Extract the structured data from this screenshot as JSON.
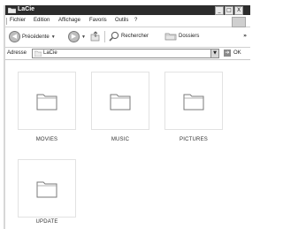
{
  "window": {
    "title": "LaCie",
    "minimize": "_",
    "maximize": "□",
    "close": "X"
  },
  "menu": [
    "Fichier",
    "Edition",
    "Affichage",
    "Favoris",
    "Outils",
    "?"
  ],
  "toolbar": {
    "back_label": "Précédente",
    "search_label": "Rechercher",
    "folders_label": "Dossiers",
    "more": "»"
  },
  "address": {
    "label": "Adresse",
    "value": "LaCie",
    "go_label": "OK"
  },
  "folders": [
    {
      "name": "MOVIES"
    },
    {
      "name": "MUSIC"
    },
    {
      "name": "PICTURES"
    },
    {
      "name": "UPDATE"
    }
  ]
}
